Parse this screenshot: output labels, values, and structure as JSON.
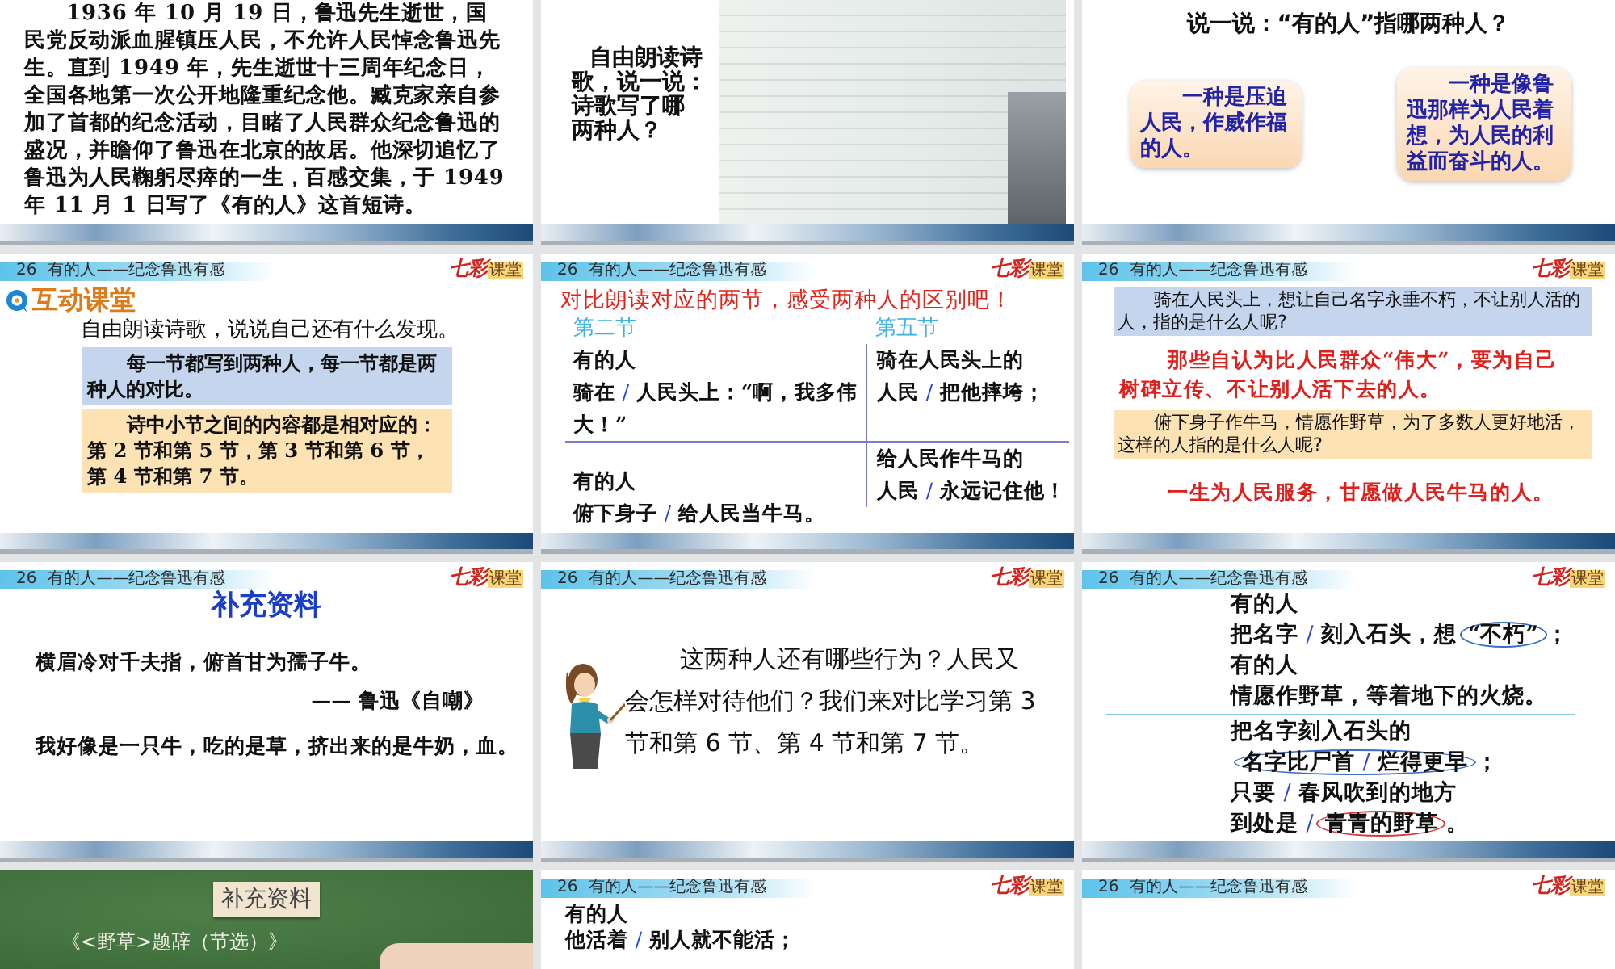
{
  "slides": [
    {
      "kind": "paragraph",
      "paragraph": "1936 年 10 月 19 日，鲁迅先生逝世，国民党反动派血腥镇压人民，不允许人民悼念鲁迅先生。直到 1949 年，先生逝世十三周年纪念日，全国各地第一次公开地隆重纪念他。臧克家亲自参加了首都的纪念活动，目睹了人民群众纪念鲁迅的盛况，并瞻仰了鲁迅在北京的故居。他深切追忆了鲁迅为人民鞠躬尽瘁的一生，百感交集，于 1949 年 11 月 1 日写了《有的人》这首短诗。",
      "wave_footer": true
    },
    {
      "kind": "image-question",
      "prompt_lines": [
        "自由朗读诗",
        "歌，说一说：",
        "诗歌写了哪",
        "两种人？"
      ],
      "wave_footer": true
    },
    {
      "kind": "two-answers",
      "question": "说一说：“有的人”指哪两种人？",
      "answers": [
        "一种是压迫人民，作威作福的人。",
        "一种是像鲁迅那样为人民着想，为人民的利益而奋斗的人。"
      ],
      "wave_footer": true
    },
    {
      "kind": "discovery",
      "header": {
        "number": "26",
        "title": "有的人——纪念鲁迅有感"
      },
      "logo": {
        "brand": "七彩",
        "label": "课堂"
      },
      "section_title": "互动课堂",
      "instruction": "自由朗读诗歌，说说自己还有什么发现。",
      "notes": [
        {
          "text": "每一节都写到两种人，每一节都是两种人的对比。",
          "color": "#c5d5ee"
        },
        {
          "text": "诗中小节之间的内容都是相对应的：第 2 节和第 5 节，第 3 节和第 6 节，第 4 节和第 7 节。",
          "color": "#fde2b4"
        }
      ],
      "wave_footer": true
    },
    {
      "kind": "comparison",
      "header": {
        "number": "26",
        "title": "有的人——纪念鲁迅有感"
      },
      "logo": {
        "brand": "七彩",
        "label": "课堂"
      },
      "title": "对比朗读对应的两节，感受两种人的区别吧！",
      "columns": [
        {
          "heading": "第二节",
          "stanzas": [
            [
              [
                {
                  "kind": "text",
                  "text": "有的人"
                }
              ],
              [
                {
                  "kind": "text",
                  "text": "骑在 "
                },
                {
                  "kind": "pause",
                  "text": "/"
                },
                {
                  "kind": "text",
                  "text": " 人民头上：“啊，我多伟"
                }
              ],
              [
                {
                  "kind": "text",
                  "text": "大！”"
                }
              ]
            ],
            [
              [
                {
                  "kind": "text",
                  "text": "有的人"
                }
              ],
              [
                {
                  "kind": "text",
                  "text": "俯下身子 "
                },
                {
                  "kind": "pause",
                  "text": "/"
                },
                {
                  "kind": "text",
                  "text": " 给人民当牛马。"
                }
              ]
            ]
          ]
        },
        {
          "heading": "第五节",
          "stanzas": [
            [
              [
                {
                  "kind": "text",
                  "text": "骑在人民头上的"
                }
              ],
              [
                {
                  "kind": "text",
                  "text": "人民 "
                },
                {
                  "kind": "pause",
                  "text": "/"
                },
                {
                  "kind": "text",
                  "text": " 把他摔垮；"
                }
              ]
            ],
            [
              [
                {
                  "kind": "text",
                  "text": "给人民作牛马的"
                }
              ],
              [
                {
                  "kind": "text",
                  "text": "人民 "
                },
                {
                  "kind": "pause",
                  "text": "/"
                },
                {
                  "kind": "text",
                  "text": " 永远记住他！"
                }
              ]
            ]
          ]
        }
      ],
      "wave_footer": true
    },
    {
      "kind": "questions",
      "header": {
        "number": "26",
        "title": "有的人——纪念鲁迅有感"
      },
      "logo": {
        "brand": "七彩",
        "label": "课堂"
      },
      "qa": [
        {
          "question": "骑在人民头上，想让自己名字永垂不朽，不让别人活的人，指的是什么人呢?",
          "answer": "那些自认为比人民群众“伟大”，要为自己树碑立传、不让别人活下去的人。",
          "color": "#c5d5ee"
        },
        {
          "question": "俯下身子作牛马，情愿作野草，为了多数人更好地活，这样的人指的是什么人呢?",
          "answer": "一生为人民服务，甘愿做人民牛马的人。",
          "color": "#fde2b4"
        }
      ],
      "wave_footer": true
    },
    {
      "kind": "quotes",
      "header": {
        "number": "26",
        "title": "有的人——纪念鲁迅有感"
      },
      "logo": {
        "brand": "七彩",
        "label": "课堂"
      },
      "title": "补充资料",
      "quotes": [
        {
          "text": "横眉冷对千夫指，俯首甘为孺子牛。",
          "source": "—— 鲁迅《自嘲》"
        },
        {
          "text": "我好像是一只牛，吃的是草，挤出来的是牛奶，血。"
        }
      ],
      "wave_footer": true
    },
    {
      "kind": "teacher-prompt",
      "header": {
        "number": "26",
        "title": "有的人——纪念鲁迅有感"
      },
      "logo": {
        "brand": "七彩",
        "label": "课堂"
      },
      "prompt": "这两种人还有哪些行为？人民又会怎样对待他们？我们来对比学习第 3 节和第 6 节、第 4 节和第 7 节。",
      "wave_footer": true
    },
    {
      "kind": "divided-verse",
      "header": {
        "number": "26",
        "title": "有的人——纪念鲁迅有感"
      },
      "logo": {
        "brand": "七彩",
        "label": "课堂"
      },
      "stanzas": [
        [
          [
            {
              "kind": "text",
              "text": "有的人"
            }
          ],
          [
            {
              "kind": "text",
              "text": "把名字 "
            },
            {
              "kind": "pause",
              "text": "/"
            },
            {
              "kind": "text",
              "text": " 刻入石头，想"
            },
            {
              "kind": "ring",
              "color": "#3b6cc9",
              "parts": [
                {
                  "kind": "text",
                  "text": "“不朽”"
                }
              ]
            },
            {
              "kind": "text",
              "text": "；"
            }
          ],
          [
            {
              "kind": "text",
              "text": "有的人"
            }
          ],
          [
            {
              "kind": "text",
              "text": "情愿作野草，等着地下的火烧。"
            }
          ]
        ],
        [
          [
            {
              "kind": "text",
              "text": "把名字刻入石头的"
            }
          ],
          [
            {
              "kind": "ring",
              "color": "#3b6cc9",
              "parts": [
                {
                  "kind": "text",
                  "text": "名字比尸首 "
                },
                {
                  "kind": "pause",
                  "text": "/"
                },
                {
                  "kind": "text",
                  "text": " 烂得更早"
                }
              ]
            },
            {
              "kind": "text",
              "text": "；"
            }
          ],
          [
            {
              "kind": "text",
              "text": "只要 "
            },
            {
              "kind": "pause",
              "text": "/"
            },
            {
              "kind": "text",
              "text": " 春风吹到的地方"
            }
          ],
          [
            {
              "kind": "text",
              "text": "到处是 "
            },
            {
              "kind": "pause",
              "text": "/"
            },
            {
              "kind": "ring",
              "color": "#d83a3a",
              "parts": [
                {
                  "kind": "text",
                  "text": "青青的野草"
                }
              ]
            },
            {
              "kind": "text",
              "text": "。"
            }
          ]
        ]
      ],
      "wave_footer": true
    },
    {
      "kind": "chalkboard",
      "label": "补充资料",
      "lines": [
        "《<野草>题辞（节选）》"
      ]
    },
    {
      "kind": "verse",
      "header": {
        "number": "26",
        "title": "有的人——纪念鲁迅有感"
      },
      "logo": {
        "brand": "七彩",
        "label": "课堂"
      },
      "stanzas": [
        [
          [
            {
              "kind": "text",
              "text": "有的人"
            }
          ],
          [
            {
              "kind": "text",
              "text": "他活着 "
            },
            {
              "kind": "pause",
              "text": "/"
            },
            {
              "kind": "text",
              "text": " 别人就不能活；"
            }
          ]
        ]
      ]
    },
    {
      "kind": "plain",
      "header": {
        "number": "26",
        "title": "有的人——纪念鲁迅有感"
      },
      "logo": {
        "brand": "七彩",
        "label": "课堂"
      }
    }
  ]
}
